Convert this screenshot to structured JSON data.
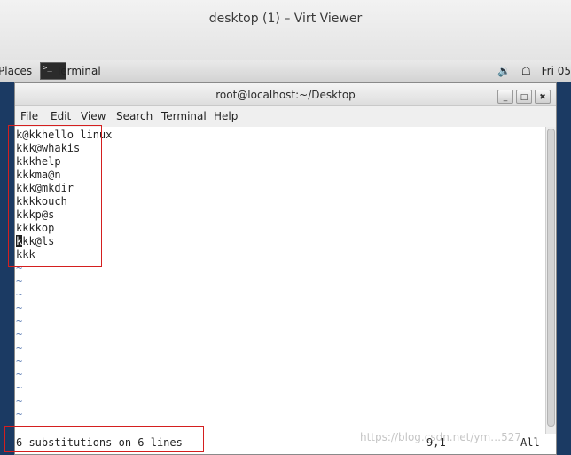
{
  "window": {
    "title": "desktop (1) – Virt Viewer"
  },
  "topbar": {
    "places_label": "Places",
    "terminal_task_label": "Terminal",
    "terminal_icon_glyph": ">_",
    "volume_icon_glyph": "🔉",
    "network_icon_glyph": "☖",
    "clock": "Fri 05"
  },
  "terminal": {
    "title": "root@localhost:~/Desktop",
    "buttons": {
      "minimize": "_",
      "maximize": "□",
      "close": "✖"
    },
    "menu": [
      "File",
      "Edit",
      "View",
      "Search",
      "Terminal",
      "Help"
    ]
  },
  "editor": {
    "lines": [
      "k@kkhello linux",
      "kkk@whakis",
      "kkkhelp",
      "kkkma@n",
      "kkk@mkdir",
      "kkkkouch",
      "kkkp@s",
      "kkkkop"
    ],
    "cursor_line": {
      "cursor_char": "k",
      "rest": "kk@ls"
    },
    "last_line": "kkk",
    "tilde": "~",
    "status_message": "6 substitutions on 6 lines",
    "cursor_position": "9,1",
    "scroll_position": "All"
  },
  "watermark": "https://blog.csdn.net/ym…527",
  "colors": {
    "annotation": "#d41f1f",
    "desktop": "#1b3a63",
    "tilde": "#5f7fb5"
  }
}
